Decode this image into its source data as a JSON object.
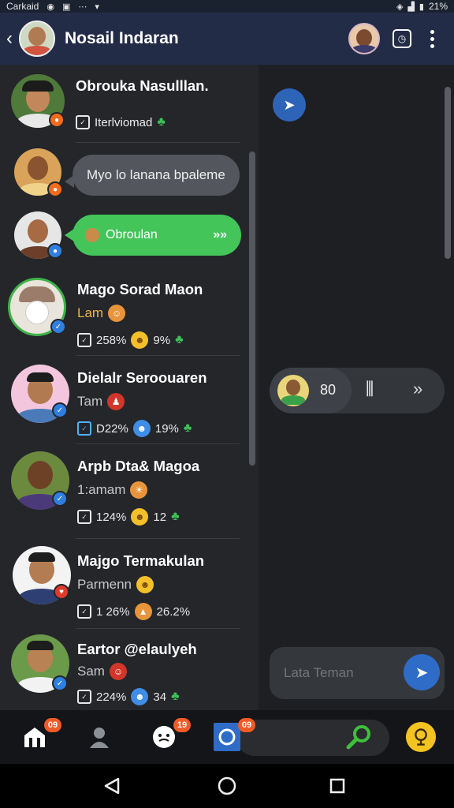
{
  "status_bar": {
    "carrier": "Carkaid",
    "battery": "21%"
  },
  "header": {
    "title": "Nosail Indaran"
  },
  "chat_list": [
    {
      "name": "Obrouka Nasulllan.",
      "sub": "Iterlviomad",
      "type": "plain"
    },
    {
      "type": "bubble",
      "bubble_text": "Myo lo lanana bpaleme"
    },
    {
      "type": "bubble_green",
      "bubble_text": "Obroulan"
    },
    {
      "name": "Mago Sorad Maon",
      "sub": "Lam",
      "stat1": "258%",
      "stat2": "9%"
    },
    {
      "name": "Dielalr Seroouaren",
      "sub": "Tam",
      "stat1": "D22%",
      "stat2": "19%"
    },
    {
      "name": "Arpb Dta& Magoa",
      "sub": "1:amam",
      "stat1": "124%",
      "stat2": "12"
    },
    {
      "name": "Majgo Termakulan",
      "sub": "Parmenn",
      "stat1": "1 26%",
      "stat2": "26.2%"
    },
    {
      "name": "Eartor @elaulyeh",
      "sub": "Sam",
      "stat1": "224%",
      "stat2": "34"
    }
  ],
  "call": {
    "count": "80"
  },
  "composer": {
    "placeholder": "Lata Teman"
  },
  "bottom_nav": {
    "badge_home": "09",
    "badge_chat": "19",
    "badge_camera": "09"
  },
  "colors": {
    "accent_blue": "#2e6cc8",
    "accent_green": "#43c55a",
    "badge_orange": "#f05b27",
    "appbar": "#232c47"
  }
}
